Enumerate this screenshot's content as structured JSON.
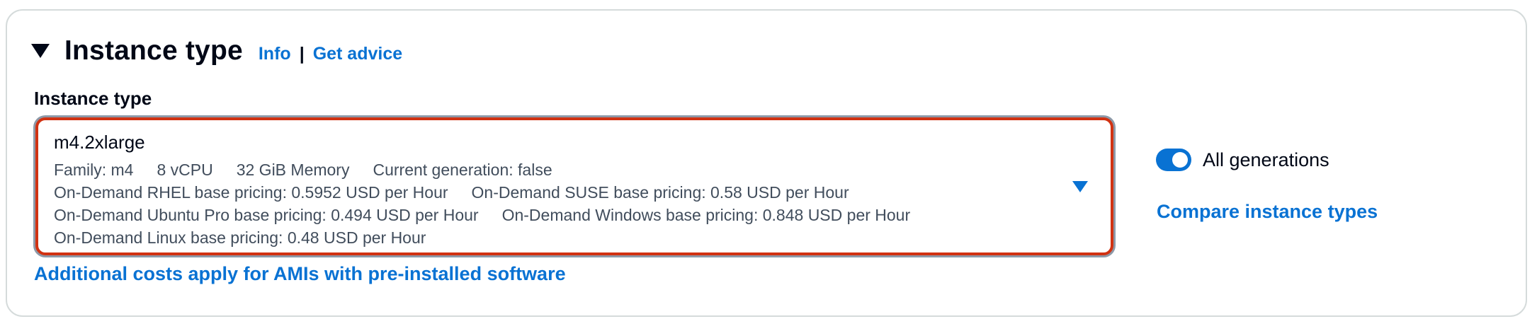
{
  "section": {
    "title": "Instance type",
    "info_link": "Info",
    "separator": "|",
    "advice_link": "Get advice"
  },
  "field": {
    "label": "Instance type",
    "selected_value": "m4.2xlarge",
    "detail_rows": [
      [
        "Family: m4",
        "8 vCPU",
        "32 GiB Memory",
        "Current generation: false"
      ],
      [
        "On-Demand RHEL base pricing: 0.5952 USD per Hour",
        "On-Demand SUSE base pricing: 0.58 USD per Hour"
      ],
      [
        "On-Demand Ubuntu Pro base pricing: 0.494 USD per Hour",
        "On-Demand Windows base pricing: 0.848 USD per Hour"
      ],
      [
        "On-Demand Linux base pricing: 0.48 USD per Hour"
      ]
    ]
  },
  "footer": {
    "additional_costs_link": "Additional costs apply for AMIs with pre-installed software"
  },
  "sidebar": {
    "toggle_label": "All generations",
    "toggle_on": true,
    "compare_link": "Compare instance types"
  },
  "colors": {
    "accent": "#0972d3",
    "error_border": "#d13212",
    "text": "#000716",
    "secondary_text": "#414d5c"
  },
  "icons": {
    "collapse": "caret-down-icon",
    "dropdown": "dropdown-arrow-icon"
  }
}
